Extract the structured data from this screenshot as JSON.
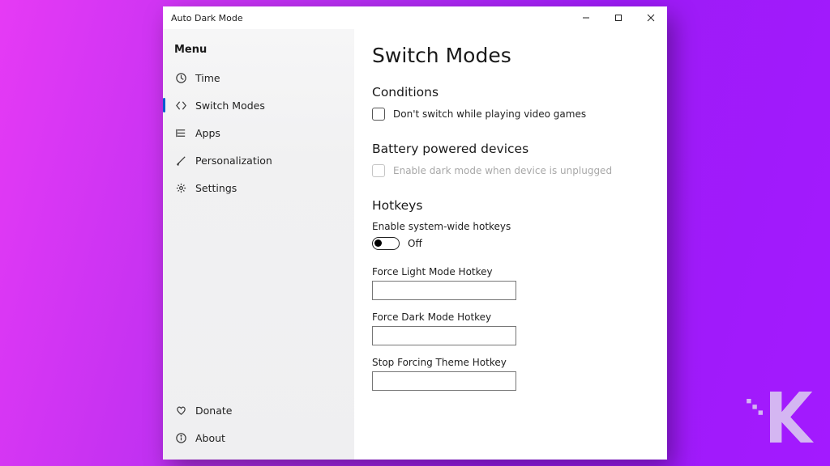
{
  "window": {
    "title": "Auto Dark Mode"
  },
  "sidebar": {
    "menu_label": "Menu",
    "items": [
      {
        "id": "time",
        "label": "Time"
      },
      {
        "id": "switch-modes",
        "label": "Switch Modes"
      },
      {
        "id": "apps",
        "label": "Apps"
      },
      {
        "id": "personalization",
        "label": "Personalization"
      },
      {
        "id": "settings",
        "label": "Settings"
      }
    ],
    "footer": [
      {
        "id": "donate",
        "label": "Donate"
      },
      {
        "id": "about",
        "label": "About"
      }
    ],
    "active_id": "switch-modes"
  },
  "page": {
    "title": "Switch Modes",
    "conditions": {
      "heading": "Conditions",
      "no_switch_games": {
        "label": "Don't switch while playing video games",
        "checked": false
      }
    },
    "battery": {
      "heading": "Battery powered devices",
      "enable_dark_unplugged": {
        "label": "Enable dark mode when device is unplugged",
        "checked": false,
        "enabled": false
      }
    },
    "hotkeys": {
      "heading": "Hotkeys",
      "enable_system_wide": {
        "label": "Enable system-wide hotkeys",
        "state_label": "Off",
        "on": false
      },
      "force_light": {
        "label": "Force Light Mode Hotkey",
        "value": ""
      },
      "force_dark": {
        "label": "Force Dark Mode Hotkey",
        "value": ""
      },
      "stop_forcing": {
        "label": "Stop Forcing Theme Hotkey",
        "value": ""
      }
    }
  }
}
